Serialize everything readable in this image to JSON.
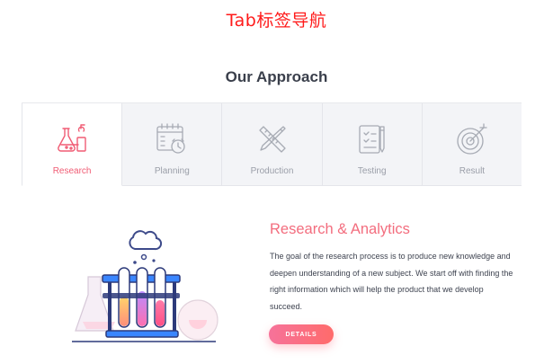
{
  "banner": {
    "text": "Tab标签导航"
  },
  "section": {
    "title": "Our Approach"
  },
  "tabs": [
    {
      "label": "Research",
      "icon": "research-lab-icon",
      "active": true
    },
    {
      "label": "Planning",
      "icon": "calendar-clock-icon",
      "active": false
    },
    {
      "label": "Production",
      "icon": "pencil-ruler-icon",
      "active": false
    },
    {
      "label": "Testing",
      "icon": "checklist-pen-icon",
      "active": false
    },
    {
      "label": "Result",
      "icon": "target-icon",
      "active": false
    }
  ],
  "panel": {
    "title": "Research & Analytics",
    "body": "The goal of the research process is to produce new knowledge and deepen understanding of a new subject. We start off with finding the right information which will help the product that we develop succeed.",
    "button_label": "DETAILS",
    "illustration": "test-tubes-illustration"
  },
  "colors": {
    "accent": "#f36d7e",
    "button_gradient_start": "#f6729a",
    "button_gradient_end": "#ff6b6b",
    "banner": "#ff1a1a",
    "title": "#3a3f4b"
  }
}
